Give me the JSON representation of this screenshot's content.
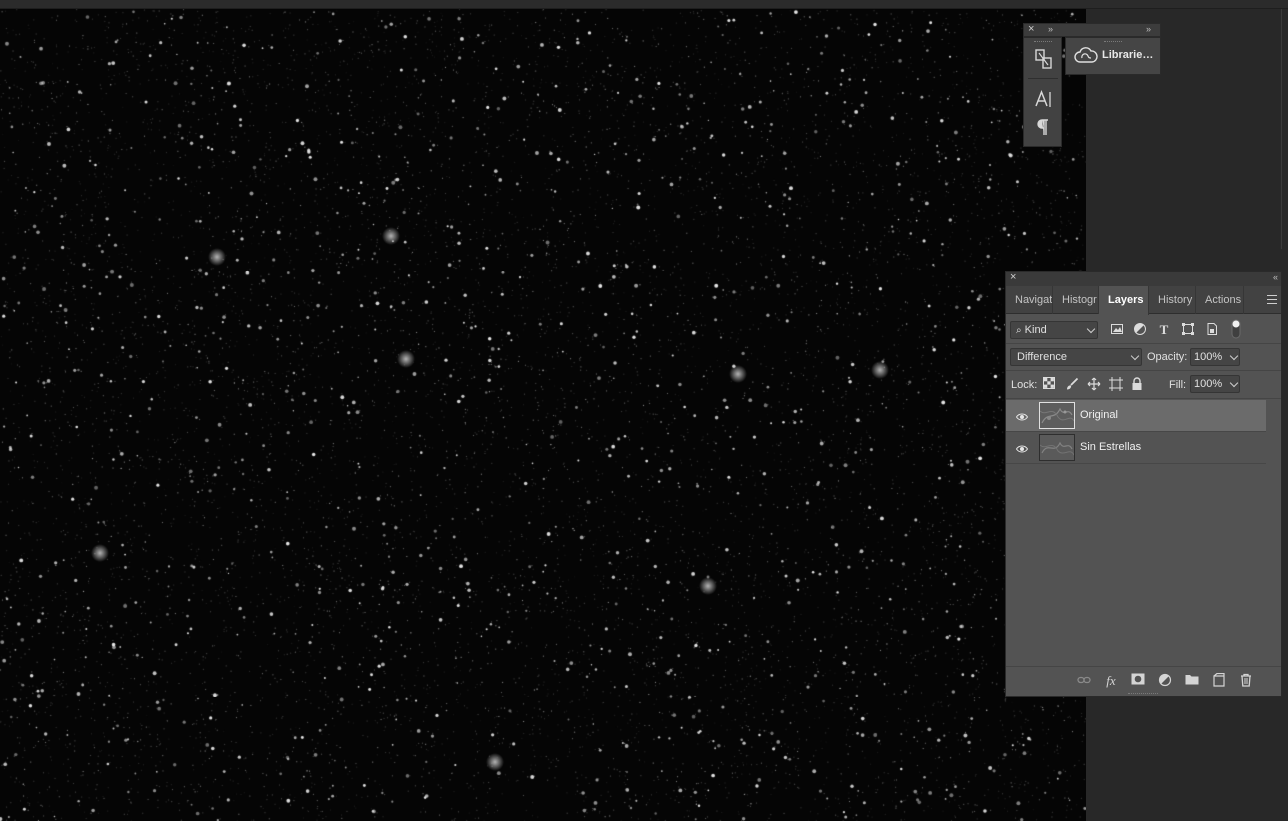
{
  "dock": {
    "close_glyph": "×",
    "collapse_glyph": "»",
    "libraries_label": "Librarie…",
    "icons": [
      "artboard-icon",
      "character-icon",
      "paragraph-icon",
      "libraries-icon"
    ]
  },
  "layers_panel": {
    "close_glyph": "×",
    "collapse_glyph": "«",
    "tabs": [
      {
        "label": "Navigat",
        "active": false
      },
      {
        "label": "Histogr",
        "active": false
      },
      {
        "label": "Layers",
        "active": true
      },
      {
        "label": "History",
        "active": false
      },
      {
        "label": "Actions",
        "active": false
      }
    ],
    "filter": {
      "value": "Kind"
    },
    "blend_mode": {
      "value": "Difference"
    },
    "opacity": {
      "label": "Opacity:",
      "value": "100%"
    },
    "lock": {
      "label": "Lock:"
    },
    "fill": {
      "label": "Fill:",
      "value": "100%"
    },
    "layers": [
      {
        "name": "Original",
        "visible": true,
        "selected": true
      },
      {
        "name": "Sin Estrellas",
        "visible": true,
        "selected": false
      }
    ],
    "footer_icons": [
      "link-layers-icon",
      "fx-icon",
      "add-mask-icon",
      "adjustment-layer-icon",
      "new-group-icon",
      "new-layer-icon",
      "delete-layer-icon"
    ],
    "fx_label": "fx"
  },
  "colors": {
    "app_bg": "#282828",
    "panel_bg": "#535353",
    "selected_layer": "#6b6b6b",
    "canvas_bg": "#050505"
  }
}
